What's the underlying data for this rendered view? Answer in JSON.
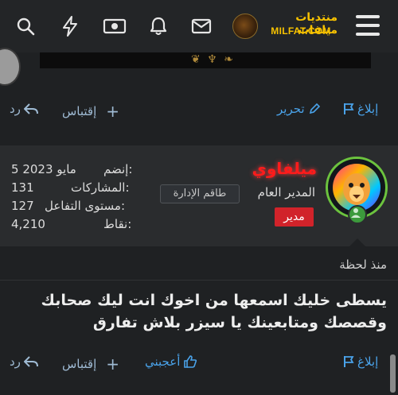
{
  "header": {
    "logo_line1": "منتديات ميلفات",
    "logo_line2": "MILFAT.COM",
    "icons": [
      "menu-icon",
      "bell-icon",
      "money-icon",
      "lightning-icon",
      "envelope-icon",
      "search-icon"
    ]
  },
  "prev_post_actions": {
    "report": "إبلاغ",
    "edit": "تحرير",
    "quote": "إقتباس",
    "reply": "رد"
  },
  "post": {
    "username": "ميلفاوي",
    "user_title": "المدير العام",
    "staff_badge": "طاقم الإدارة",
    "role_badge": "مدير",
    "stats": {
      "joined_label": "إنضم:",
      "joined_value": "5 مايو 2023",
      "posts_label": "المشاركات:",
      "posts_value": "131",
      "reactions_label": "مستوى التفاعل:",
      "reactions_value": "127",
      "points_label": "نقاط:",
      "points_value": "4,210"
    },
    "time": "منذ لحظة",
    "message": "يسطى خليك اسمعها من اخوك انت ليك صحابك وقصصك ومتابعينك يا سيزر بلاش تفارق",
    "actions": {
      "report": "إبلاغ",
      "like": "أعجبني",
      "quote": "إقتباس",
      "reply": "رد"
    }
  },
  "colors": {
    "accent_link": "#4aa3ea",
    "username": "#ff1b1b",
    "logo": "#f7c200",
    "role_badge": "#d1232a",
    "online": "#3c9a3c"
  }
}
